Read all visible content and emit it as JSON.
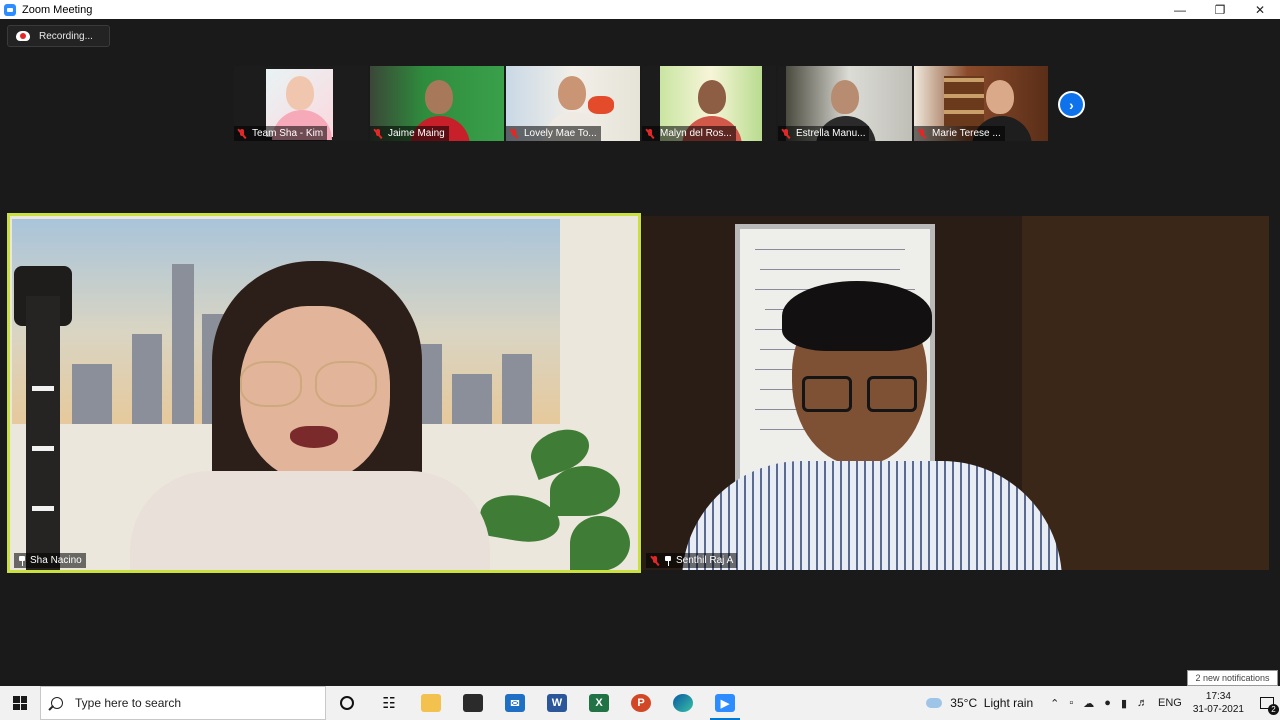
{
  "window": {
    "title": "Zoom Meeting"
  },
  "recording": {
    "label": "Recording..."
  },
  "thumbnails": [
    {
      "name": "Team Sha - Kim",
      "muted": true
    },
    {
      "name": "Jaime Maing",
      "muted": true
    },
    {
      "name": "Lovely Mae To...",
      "muted": true
    },
    {
      "name": "Malyn del Ros...",
      "muted": true
    },
    {
      "name": "Estrella Manu...",
      "muted": true
    },
    {
      "name": "Marie Terese ...",
      "muted": true
    }
  ],
  "main_tiles": [
    {
      "name": "Sha Nacino",
      "active_speaker": true,
      "muted": false
    },
    {
      "name": "Senthil Raj A",
      "active_speaker": false,
      "muted": true
    }
  ],
  "notifications": {
    "text": "2 new notifications",
    "count": "2"
  },
  "taskbar": {
    "search_placeholder": "Type here to search",
    "apps": [
      "cortana-icon",
      "task-view-icon",
      "file-explorer-icon",
      "store-icon",
      "mail-icon",
      "word-icon",
      "excel-icon",
      "powerpoint-icon",
      "edge-icon",
      "zoom-icon"
    ],
    "weather": {
      "temp": "35°C",
      "condition": "Light rain"
    },
    "language": "ENG",
    "time": "17:34",
    "date": "31-07-2021"
  },
  "colors": {
    "active_speaker_border": "#c9e03f",
    "zoom_blue": "#0e72ed",
    "mute_red": "#e02828"
  }
}
